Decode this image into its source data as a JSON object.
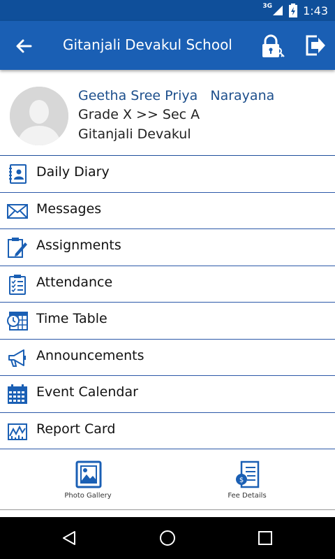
{
  "status_bar": {
    "time": "1:43",
    "network": "3G"
  },
  "app_bar": {
    "title": "Gitanjali Devakul School"
  },
  "profile": {
    "name": "Geetha Sree Priya   Narayana",
    "grade": "Grade X >> Sec A",
    "school": "Gitanjali Devakul"
  },
  "menu": [
    {
      "label": "Daily Diary",
      "icon": "diary-icon"
    },
    {
      "label": "Messages",
      "icon": "envelope-icon"
    },
    {
      "label": "Assignments",
      "icon": "clipboard-pencil-icon"
    },
    {
      "label": "Attendance",
      "icon": "checklist-icon"
    },
    {
      "label": "Time Table",
      "icon": "clock-calendar-icon"
    },
    {
      "label": "Announcements",
      "icon": "megaphone-icon"
    },
    {
      "label": "Event Calendar",
      "icon": "calendar-icon"
    },
    {
      "label": "Report Card",
      "icon": "chart-icon"
    }
  ],
  "tiles": {
    "photo_gallery": "Photo Gallery",
    "fee_details": "Fee Details"
  },
  "colors": {
    "primary": "#1a5fb4",
    "status": "#0f4f9a",
    "accent_text": "#1d4f8c"
  }
}
